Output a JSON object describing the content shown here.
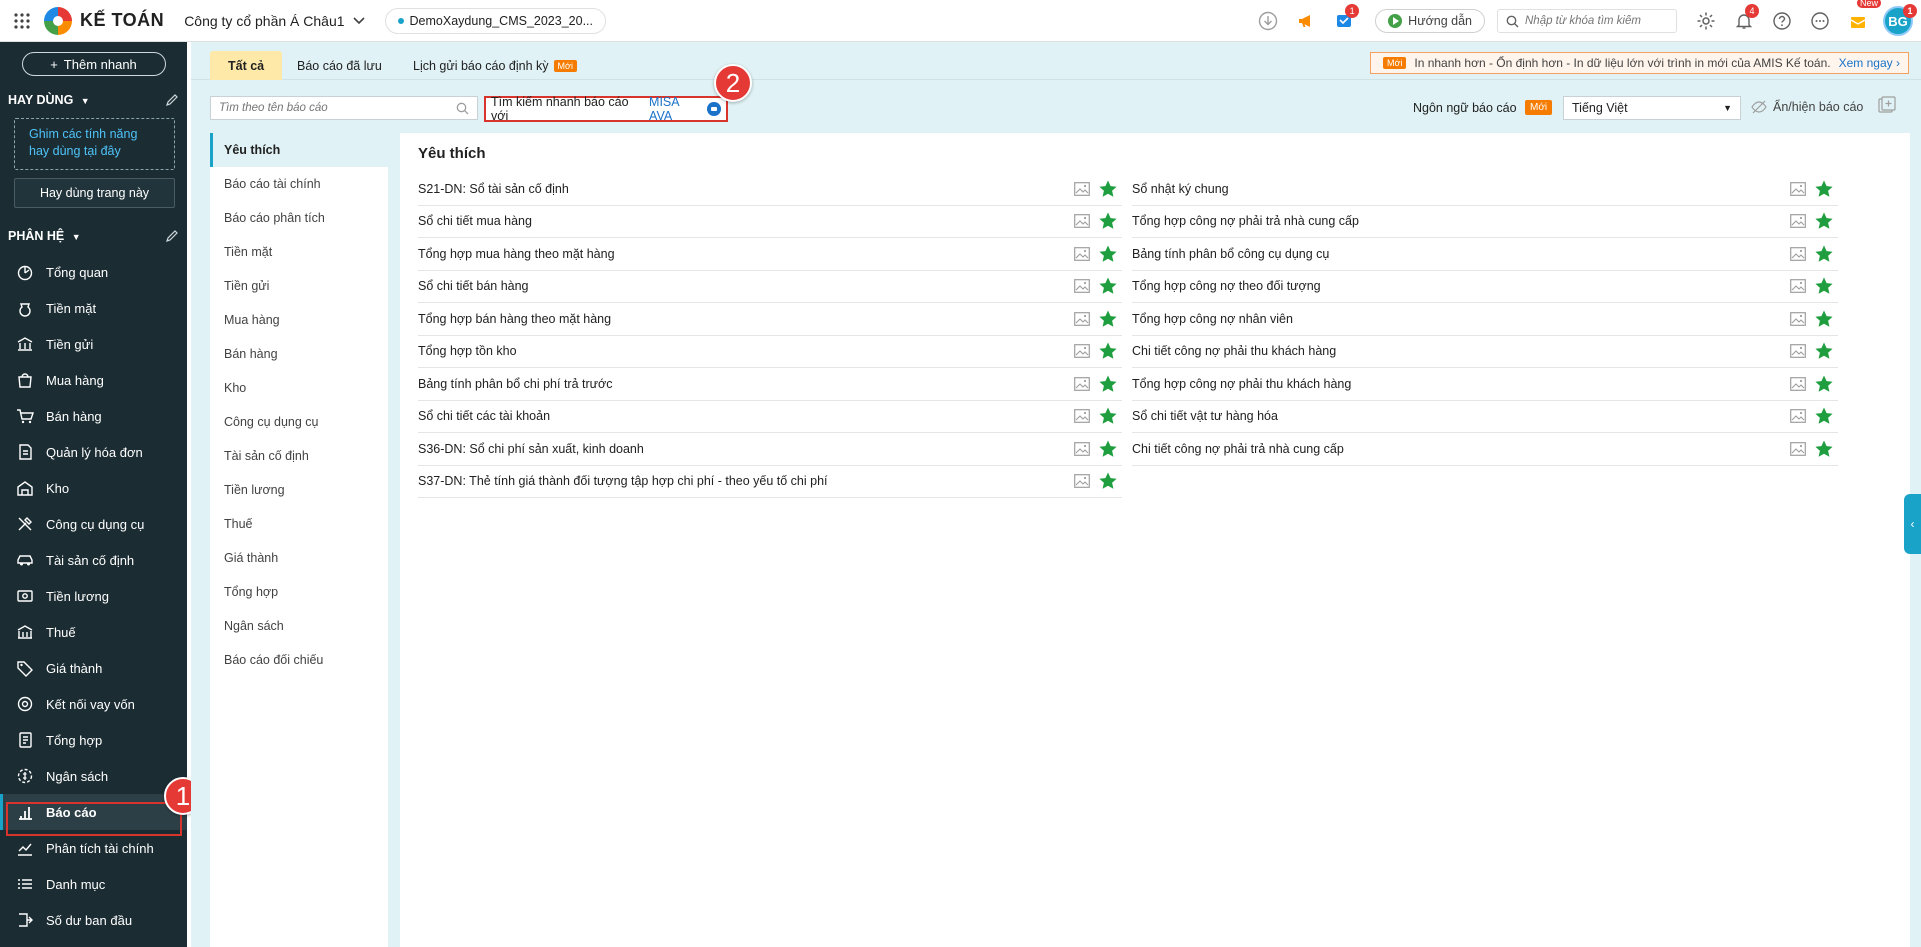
{
  "topbar": {
    "app_title": "KẾ TOÁN",
    "company": "Công ty cổ phần Á Châu1",
    "database": "DemoXaydung_CMS_2023_20...",
    "guide_label": "Hướng dẫn",
    "search_placeholder": "Nhập từ khóa tìm kiếm",
    "cart_badge": "1",
    "bell_badge": "4",
    "avatar_initials": "BG",
    "avatar_badge": "1",
    "new_tag": "New"
  },
  "sidebar": {
    "add_quick": "Thêm nhanh",
    "favorites_header": "HAY DÙNG",
    "pin_hint": "Ghim các tính năng hay dùng tại đây",
    "useful_here": "Hay dùng trang này",
    "modules_header": "PHÂN HỆ",
    "items": [
      {
        "label": "Tổng quan",
        "icon": "dashboard-icon"
      },
      {
        "label": "Tiền mặt",
        "icon": "cash-icon"
      },
      {
        "label": "Tiền gửi",
        "icon": "bank-icon"
      },
      {
        "label": "Mua hàng",
        "icon": "shopping-bag-icon"
      },
      {
        "label": "Bán hàng",
        "icon": "cart-icon"
      },
      {
        "label": "Quản lý hóa đơn",
        "icon": "invoice-icon"
      },
      {
        "label": "Kho",
        "icon": "warehouse-icon"
      },
      {
        "label": "Công cụ dụng cụ",
        "icon": "tools-icon"
      },
      {
        "label": "Tài sản cố định",
        "icon": "car-icon"
      },
      {
        "label": "Tiền lương",
        "icon": "salary-icon"
      },
      {
        "label": "Thuế",
        "icon": "tax-icon"
      },
      {
        "label": "Giá thành",
        "icon": "price-tag-icon"
      },
      {
        "label": "Kết nối vay vốn",
        "icon": "loan-icon"
      },
      {
        "label": "Tổng hợp",
        "icon": "ledger-icon"
      },
      {
        "label": "Ngân sách",
        "icon": "budget-icon"
      },
      {
        "label": "Báo cáo",
        "icon": "chart-icon"
      },
      {
        "label": "Phân tích tài chính",
        "icon": "analytics-icon"
      },
      {
        "label": "Danh mục",
        "icon": "list-icon"
      },
      {
        "label": "Số dư ban đầu",
        "icon": "balance-icon"
      }
    ],
    "active_item": "Báo cáo"
  },
  "tabs": [
    {
      "label": "Tất cả",
      "active": true
    },
    {
      "label": "Báo cáo đã lưu",
      "active": false
    },
    {
      "label": "Lịch gửi báo cáo định kỳ",
      "active": false,
      "badge": "Mới"
    }
  ],
  "banner": {
    "badge": "Mới",
    "text": "In nhanh hơn - Ổn định hơn - In dữ liệu lớn với trình in mới của AMIS Kế toán.",
    "link": "Xem ngay"
  },
  "filters": {
    "name_search_placeholder": "Tìm theo tên báo cáo",
    "ava_search_text": "Tìm kiếm nhanh báo cáo với",
    "ava_brand": "MISA AVA",
    "language_label": "Ngôn ngữ báo cáo",
    "language_badge": "Mới",
    "language_value": "Tiếng Việt",
    "toggle_label": "Ẩn/hiện báo cáo"
  },
  "categories": [
    "Yêu thích",
    "Báo cáo tài chính",
    "Báo cáo phân tích",
    "Tiền mặt",
    "Tiền gửi",
    "Mua hàng",
    "Bán hàng",
    "Kho",
    "Công cụ dụng cụ",
    "Tài sản cố định",
    "Tiền lương",
    "Thuế",
    "Giá thành",
    "Tổng hợp",
    "Ngân sách",
    "Báo cáo đối chiếu"
  ],
  "favorites": {
    "title": "Yêu thích",
    "left": [
      "S21-DN: Sổ tài sản cố định",
      "Sổ chi tiết mua hàng",
      "Tổng hợp mua hàng theo mặt hàng",
      "Sổ chi tiết bán hàng",
      "Tổng hợp bán hàng theo mặt hàng",
      "Tổng hợp tồn kho",
      "Bảng tính phân bổ chi phí trả trước",
      "Sổ chi tiết các tài khoản",
      "S36-DN: Sổ chi phí sản xuất, kinh doanh",
      "S37-DN: Thẻ tính giá thành đối tượng tập hợp chi phí - theo yếu tố chi phí"
    ],
    "right": [
      "Sổ nhật ký chung",
      "Tổng hợp công nợ phải trả nhà cung cấp",
      "Bảng tính phân bổ công cụ dụng cụ",
      "Tổng hợp công nợ theo đối tượng",
      "Tổng hợp công nợ nhân viên",
      "Chi tiết công nợ phải thu khách hàng",
      "Tổng hợp công nợ phải thu khách hàng",
      "Sổ chi tiết vật tư hàng hóa",
      "Chi tiết công nợ phải trả nhà cung cấp"
    ]
  },
  "callouts": {
    "one": "1",
    "two": "2"
  },
  "colors": {
    "sidebar_bg": "#1b2c33",
    "accent": "#1aa3c9",
    "star": "#1e9e3e",
    "callout": "#e53935",
    "main_bg": "#e0f2f5"
  }
}
